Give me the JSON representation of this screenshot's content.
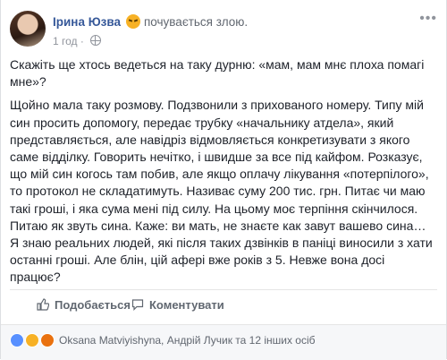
{
  "header": {
    "author": "Ірина Юзва",
    "feeling": "почувається злою.",
    "timestamp": "1 год",
    "feeling_icon": "angry-face-icon",
    "privacy_icon": "globe-icon",
    "menu_icon": "more-icon"
  },
  "post": {
    "paragraphs": [
      "Скажіть ще хтось ведеться на таку дурню: «мам, мам мнє плоха помагі мне»?",
      "Щойно мала таку розмову. Подзвонили з прихованого номеру. Типу мій син просить допомогу, передає трубку «начальнику атдела», який представляється, але навідріз відмовляється конкретизувати з якого саме відділку. Говорить нечітко, і швидше за все під кайфом. Розказує, що мій син когось там побив, але якщо оплачу лікування «потерпілого», то протокол не складатимуть. Називає суму 200 тис. грн. Питає чи маю такі гроші, і яка сума мені під силу. На цьому моє терпіння скінчилося. Питаю як звуть сина. Каже: ви мать, не знаєте как завут вашево сина… Я знаю реальних людей, які після таких дзвінків в паніці виносили з хати останні гроші. Але блін, цій афері вже років з 5. Невже вона досі працює?"
    ]
  },
  "actions": {
    "like": "Подобається",
    "comment": "Коментувати",
    "like_icon": "thumbs-up-icon",
    "comment_icon": "comment-icon"
  },
  "reactions": {
    "icons": [
      "like",
      "wow",
      "angry"
    ],
    "summary": "Oksana Matviyishyna, Андрій Лучик та 12 інших осіб",
    "colors": {
      "like": "#5890ff",
      "wow": "#f7b125",
      "angry": "#e9710f"
    }
  },
  "colors": {
    "link": "#365899",
    "secondary": "#90949c",
    "text": "#1d2129"
  }
}
